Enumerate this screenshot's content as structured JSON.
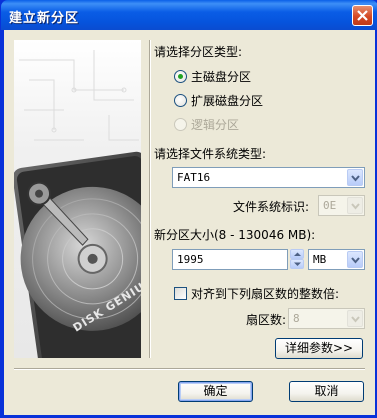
{
  "window": {
    "title": "建立新分区"
  },
  "partition_type": {
    "label": "请选择分区类型:",
    "options": [
      {
        "label": "主磁盘分区",
        "selected": true,
        "enabled": true
      },
      {
        "label": "扩展磁盘分区",
        "selected": false,
        "enabled": true
      },
      {
        "label": "逻辑分区",
        "selected": false,
        "enabled": false
      }
    ]
  },
  "filesystem": {
    "label": "请选择文件系统类型:",
    "value": "FAT16",
    "id_label": "文件系统标识:",
    "id_value": "0E"
  },
  "size": {
    "label": "新分区大小(8 - 130046 MB):",
    "value": "1995",
    "unit": "MB"
  },
  "align": {
    "label": "对齐到下列扇区数的整数倍:",
    "checked": false,
    "sector_label": "扇区数:",
    "sector_value": "8"
  },
  "buttons": {
    "advanced": "详细参数>>",
    "ok": "确定",
    "cancel": "取消"
  },
  "sidebar": {
    "brand": "DISK GENIUS"
  },
  "colors": {
    "titlebar": "#0a5de6",
    "dialog_bg": "#ece9d8",
    "radio_dot": "#21a121"
  }
}
